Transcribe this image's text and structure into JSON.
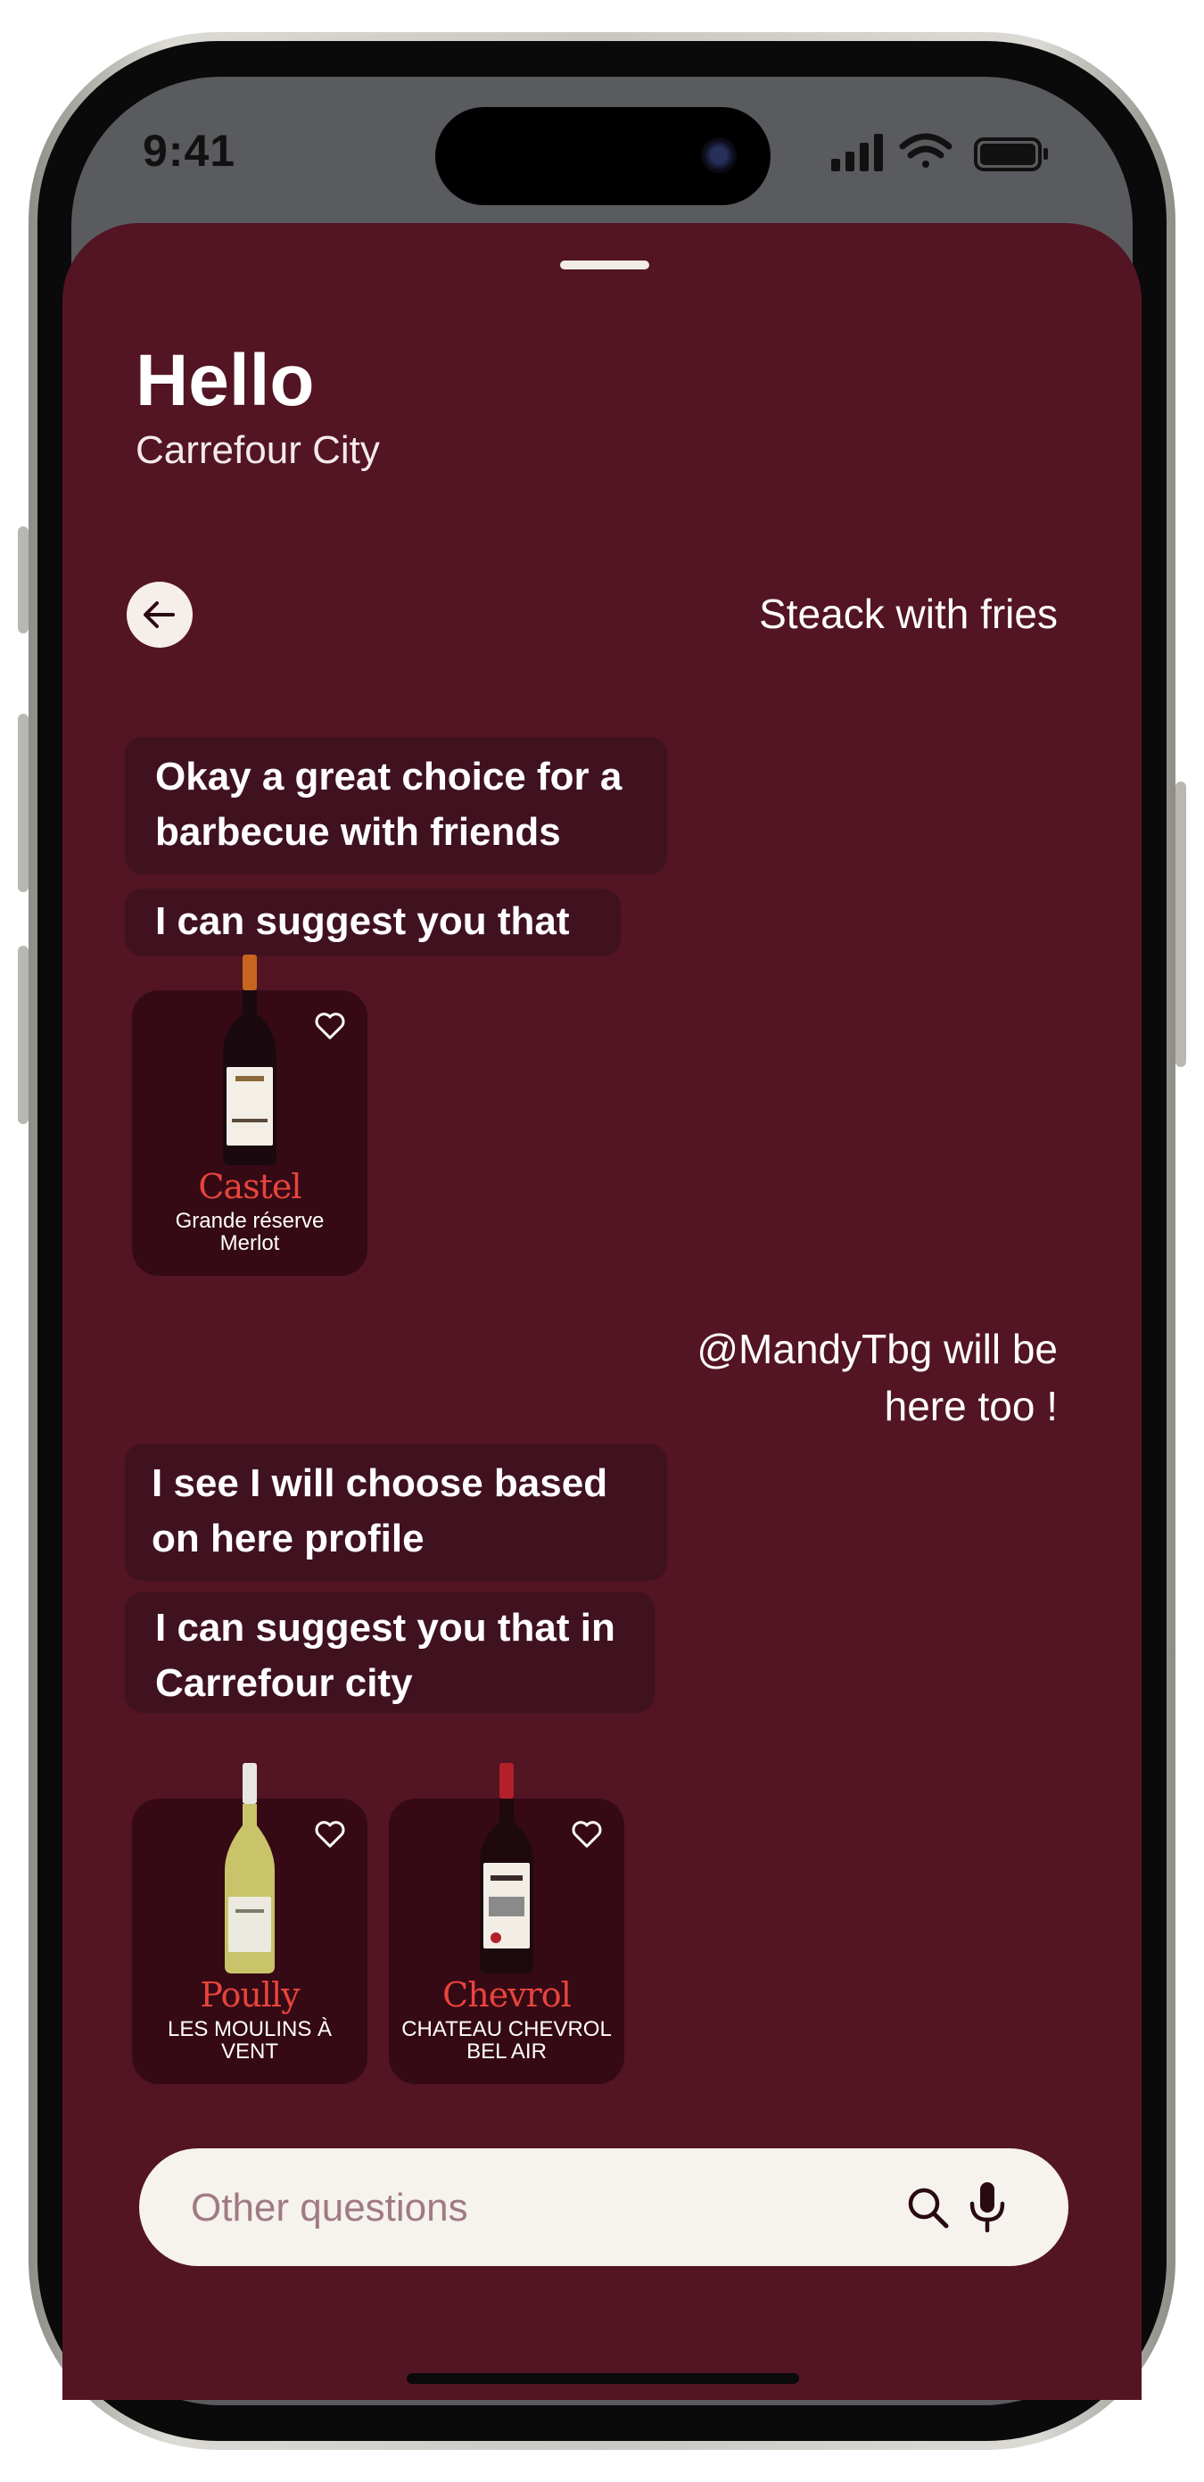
{
  "status_bar": {
    "time": "9:41"
  },
  "header": {
    "greeting": "Hello",
    "store_name": "Carrefour City"
  },
  "conversation": {
    "user_message_1": "Steack with fries",
    "bot_message_1": "Okay a great choice for a barbecue with friends",
    "bot_message_2": "I can suggest you that",
    "user_message_2_line_1": "@MandyTbg will be",
    "user_message_2_line_2": "here too !",
    "bot_message_3": "I see I will choose based on here profile",
    "bot_message_4": "I can suggest you that in Carrefour city"
  },
  "wines": [
    {
      "brand": "Castel",
      "line1": "Grande réserve",
      "line2": "Merlot",
      "icon": "red-wine-bottle-icon"
    },
    {
      "brand": "Poully",
      "line1": "LES MOULINS À",
      "line2": "VENT",
      "icon": "white-wine-bottle-icon"
    },
    {
      "brand": "Chevrol",
      "line1": "CHATEAU CHEVROL",
      "line2": "BEL AIR",
      "icon": "red-wine-bottle-icon"
    }
  ],
  "search": {
    "placeholder": "Other questions"
  },
  "colors": {
    "sheet": "#531424",
    "bubble": "#401220",
    "card": "#350a15",
    "brand_red": "#e8443c",
    "search_bg": "#f6f2ee"
  }
}
